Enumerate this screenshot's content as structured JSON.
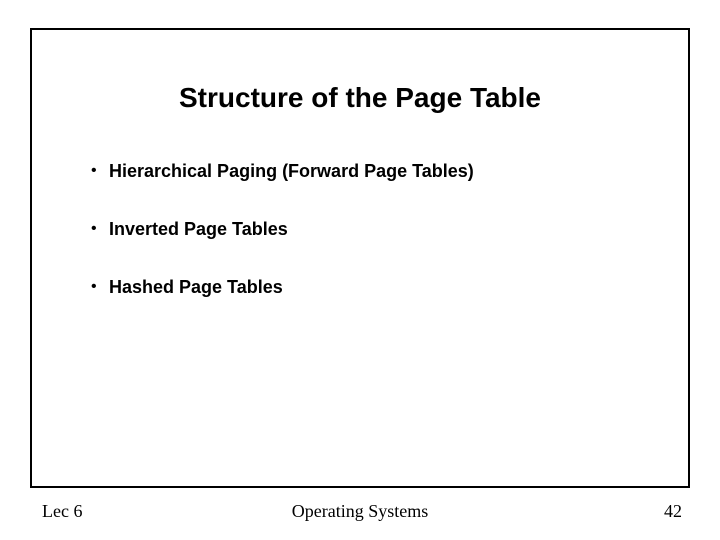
{
  "title": "Structure of the Page Table",
  "bullets": [
    "Hierarchical Paging (Forward Page Tables)",
    "Inverted Page Tables",
    "Hashed Page Tables"
  ],
  "footer": {
    "left": "Lec 6",
    "center": "Operating Systems",
    "right": "42"
  }
}
